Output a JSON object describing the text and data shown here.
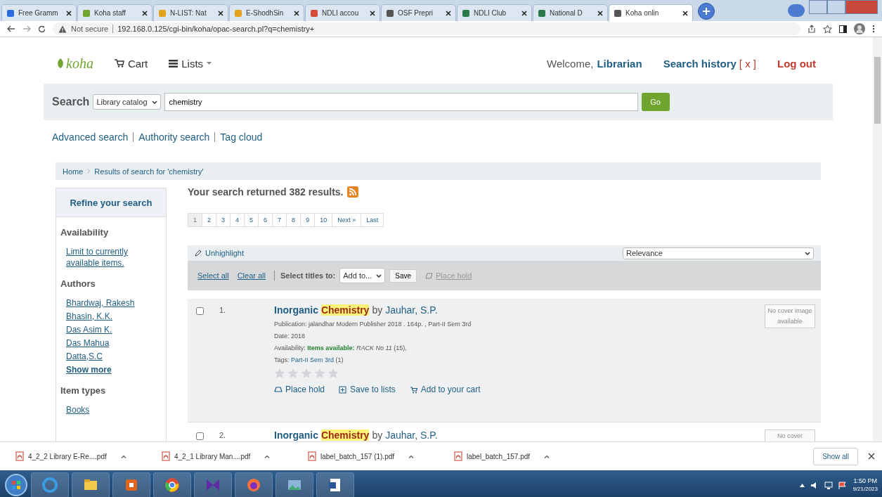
{
  "browser": {
    "tabs": [
      {
        "title": "Free Gramm",
        "selected": false
      },
      {
        "title": "Koha staff",
        "selected": false
      },
      {
        "title": "N-LIST: Nat",
        "selected": false
      },
      {
        "title": "E-ShodhSin",
        "selected": false
      },
      {
        "title": "NDLI accou",
        "selected": false
      },
      {
        "title": "OSF Prepri",
        "selected": false
      },
      {
        "title": "NDLI Club",
        "selected": false
      },
      {
        "title": "National D",
        "selected": false
      },
      {
        "title": "Koha onlin",
        "selected": true
      }
    ],
    "address": {
      "security": "Not secure",
      "url": "192.168.0.125/cgi-bin/koha/opac-search.pl?q=chemistry+"
    }
  },
  "header": {
    "logo": "koha",
    "cart": "Cart",
    "lists": "Lists",
    "welcome": "Welcome,",
    "user": "Librarian",
    "search_history": "Search history",
    "clear_history": "[ x ]",
    "logout": "Log out"
  },
  "search": {
    "label": "Search",
    "scope": "Library catalog",
    "query": "chemistry",
    "button": "Go"
  },
  "links": [
    "Advanced search",
    "Authority search",
    "Tag cloud"
  ],
  "breadcrumbs": [
    "Home",
    "Results of search for 'chemistry'"
  ],
  "sidebar": {
    "title": "Refine your search",
    "sections": [
      {
        "heading": "Availability",
        "links": [
          "Limit to currently available items."
        ]
      },
      {
        "heading": "Authors",
        "links": [
          "Bhardwaj, Rakesh",
          "Bhasin, K.K.",
          "Das Asim K.",
          "Das Mahua",
          "Datta,S.C"
        ],
        "more": "Show more"
      },
      {
        "heading": "Item types",
        "links": [
          "Books"
        ]
      }
    ]
  },
  "results": {
    "summary": "Your search returned 382 results.",
    "pages": [
      {
        "label": "1",
        "selected": true
      },
      {
        "label": "2",
        "selected": false
      },
      {
        "label": "3",
        "selected": false
      },
      {
        "label": "4",
        "selected": false
      },
      {
        "label": "5",
        "selected": false
      },
      {
        "label": "6",
        "selected": false
      },
      {
        "label": "7",
        "selected": false
      },
      {
        "label": "8",
        "selected": false
      },
      {
        "label": "9",
        "selected": false
      },
      {
        "label": "10",
        "selected": false
      },
      {
        "label": "Next »",
        "selected": false
      },
      {
        "label": "Last",
        "selected": false
      }
    ],
    "unhighlight": "Unhighlight",
    "sort": "Relevance",
    "toolbar": {
      "select_all": "Select all",
      "clear_all": "Clear all",
      "select_titles": "Select titles to:",
      "add_to": "Add to...",
      "save": "Save",
      "place_hold": "Place hold",
      "place_hold_disabled": true
    },
    "items": [
      {
        "number": "1.",
        "checked": false,
        "title": "Inorganic **Chemistry**",
        "by": "by",
        "author": "Jauhar, S.P.",
        "publication": "Publication: jalandhar Modern Publisher 2018 . 164p. , Part-II Sem 3rd",
        "date": "Date: 2018",
        "availability": "Availability: **Items available:** *RACK No 11* (15),",
        "tags_label": "Tags:",
        "tag": "Part-II Sem 3rd",
        "tag_count": "(1)",
        "stars": 0,
        "actions": [
          "Place hold",
          "Save to lists",
          "Add to your cart"
        ],
        "cover": "No cover image available"
      },
      {
        "number": "2.",
        "checked": false,
        "title": "Inorganic **Chemistry**",
        "by": "by",
        "author": "Jauhar, S.P.",
        "cover": "No cover"
      }
    ]
  },
  "downloads": {
    "items": [
      "4_2_2 Library E-Re....pdf",
      "4_2_1 Library Man....pdf",
      "label_batch_157 (1).pdf",
      "label_batch_157.pdf"
    ],
    "show_all": "Show all"
  },
  "taskbar": {
    "time": "1:50 PM",
    "date": "9/21/2023"
  }
}
